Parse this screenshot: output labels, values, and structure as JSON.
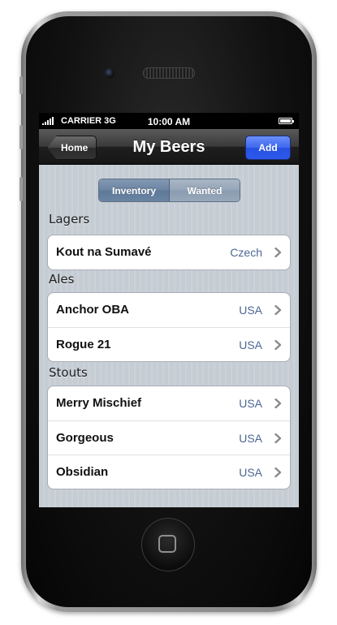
{
  "status_bar": {
    "carrier": "CARRIER 3G",
    "time": "10:00 AM"
  },
  "nav": {
    "back_label": "Home",
    "title": "My Beers",
    "add_label": "Add"
  },
  "segmented": {
    "options": [
      "Inventory",
      "Wanted"
    ],
    "selected": "Inventory"
  },
  "sections": [
    {
      "header": "Lagers",
      "rows": [
        {
          "name": "Kout na Sumavé",
          "origin": "Czech"
        }
      ]
    },
    {
      "header": "Ales",
      "rows": [
        {
          "name": "Anchor OBA",
          "origin": "USA"
        },
        {
          "name": "Rogue 21",
          "origin": "USA"
        }
      ]
    },
    {
      "header": "Stouts",
      "rows": [
        {
          "name": "Merry Mischief",
          "origin": "USA"
        },
        {
          "name": "Gorgeous",
          "origin": "USA"
        },
        {
          "name": "Obsidian",
          "origin": "USA"
        }
      ]
    }
  ],
  "icons": {
    "row_accessory": "chevron-right-icon",
    "home_button": "home-square-icon"
  },
  "colors": {
    "add_button": "#2d59ea",
    "detail_text": "#4c6692"
  }
}
